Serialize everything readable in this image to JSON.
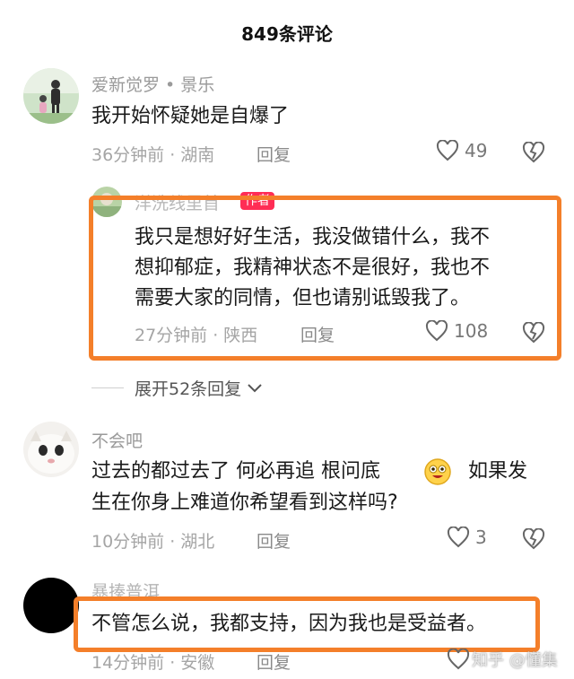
{
  "header": {
    "title": "849条评论"
  },
  "comments": [
    {
      "username": "爱新觉罗 • 景乐",
      "text": "我开始怀疑她是自爆了",
      "time_location": "36分钟前 · 湖南",
      "reply_label": "回复",
      "likes": "49"
    },
    {
      "username": "洋洗线里首",
      "badge": "作者",
      "text_lines": [
        "我只是想好好生活，我没做错什么，我不",
        "想抑郁症，我精神状态不是很好，我也不",
        "需要大家的同情，但也请别诋毁我了。"
      ],
      "time_location": "27分钟前 · 陕西",
      "reply_label": "回复",
      "likes": "108"
    },
    {
      "username": "不会吧",
      "text_lines": [
        "过去的都过去了 何必再追 根问底",
        "如果发",
        "生在你身上难道你希望看到这样吗?"
      ],
      "time_location": "10分钟前 · 湖北",
      "reply_label": "回复",
      "likes": "3"
    },
    {
      "username": "暴揍普洱",
      "text": "不管怎么说，我都支持，因为我也是受益者。",
      "time_location": "14分钟前 · 安徽",
      "reply_label": "回复"
    }
  ],
  "expand": {
    "label": "展开52条回复"
  },
  "watermark": {
    "text": "知乎 @懂集"
  },
  "colors": {
    "highlight": "#f47f2a",
    "badge": "#ff2d55"
  }
}
